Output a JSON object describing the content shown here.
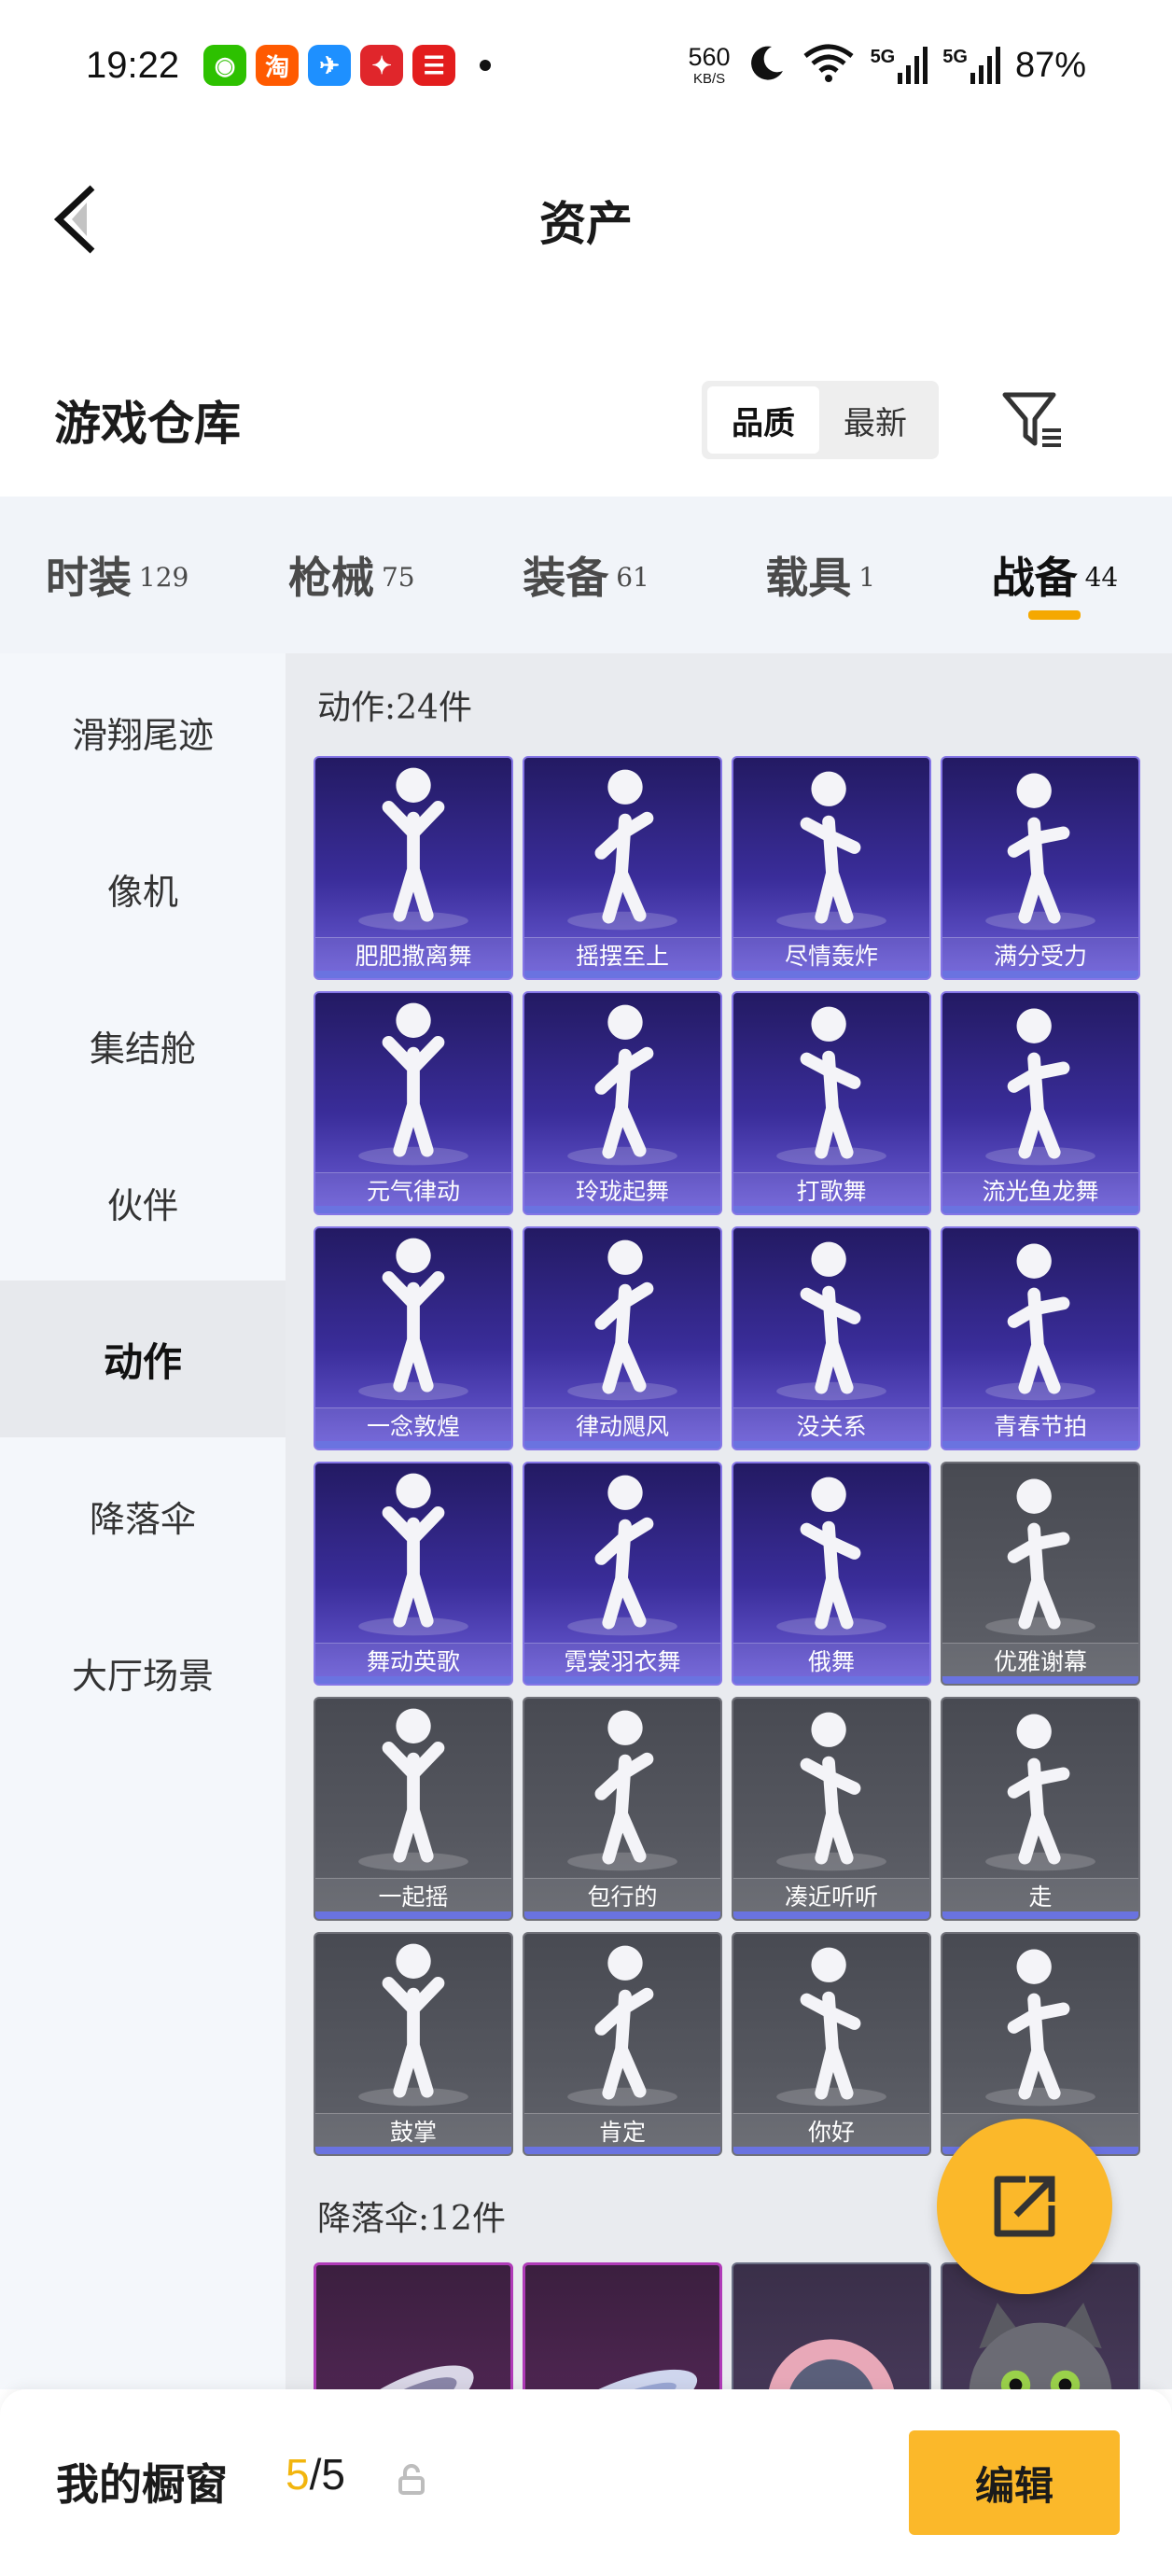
{
  "status_bar": {
    "time": "19:22",
    "apps": [
      {
        "name": "wechat-icon",
        "glyph": "◉",
        "color": "#2dc100"
      },
      {
        "name": "taobao-icon",
        "glyph": "淘",
        "color": "#ff5a00"
      },
      {
        "name": "messenger-icon",
        "glyph": "✈",
        "color": "#1e90ff"
      },
      {
        "name": "bank-icon",
        "glyph": "✦",
        "color": "#e0262b"
      },
      {
        "name": "unionpay-icon",
        "glyph": "☰",
        "color": "#e31d1d"
      }
    ],
    "net_speed": "560",
    "net_unit": "KB/S",
    "signal1": "5G",
    "signal2": "5G",
    "battery": "87%"
  },
  "header": {
    "title": "资产"
  },
  "section": {
    "title": "游戏仓库",
    "sort_options": [
      "品质",
      "最新"
    ],
    "active_sort": "品质"
  },
  "tabs": [
    {
      "label": "时装",
      "count": "129"
    },
    {
      "label": "枪械",
      "count": "75"
    },
    {
      "label": "装备",
      "count": "61"
    },
    {
      "label": "载具",
      "count": "1"
    },
    {
      "label": "战备",
      "count": "44"
    }
  ],
  "active_tab": "战备",
  "sidebar": {
    "items": [
      "滑翔尾迹",
      "像机",
      "集结舱",
      "伙伴",
      "动作",
      "降落伞",
      "大厅场景"
    ],
    "active": "动作"
  },
  "actions_group": {
    "title": "动作:24件",
    "items": [
      {
        "name": "肥肥撒离舞",
        "style": "purple"
      },
      {
        "name": "摇摆至上",
        "style": "purple"
      },
      {
        "name": "尽情轰炸",
        "style": "purple"
      },
      {
        "name": "满分受力",
        "style": "purple"
      },
      {
        "name": "元气律动",
        "style": "purple"
      },
      {
        "name": "玲珑起舞",
        "style": "purple"
      },
      {
        "name": "打歌舞",
        "style": "purple"
      },
      {
        "name": "流光鱼龙舞",
        "style": "purple"
      },
      {
        "name": "一念敦煌",
        "style": "purple"
      },
      {
        "name": "律动飓风",
        "style": "purple"
      },
      {
        "name": "没关系",
        "style": "purple"
      },
      {
        "name": "青春节拍",
        "style": "purple"
      },
      {
        "name": "舞动英歌",
        "style": "purple"
      },
      {
        "name": "霓裳羽衣舞",
        "style": "purple"
      },
      {
        "name": "俄舞",
        "style": "purple"
      },
      {
        "name": "优雅谢幕",
        "style": "grey"
      },
      {
        "name": "一起摇",
        "style": "grey"
      },
      {
        "name": "包行的",
        "style": "grey"
      },
      {
        "name": "凑近听听",
        "style": "grey"
      },
      {
        "name": "走",
        "style": "grey"
      },
      {
        "name": "鼓掌",
        "style": "grey"
      },
      {
        "name": "肯定",
        "style": "grey"
      },
      {
        "name": "你好",
        "style": "grey"
      },
      {
        "name": "",
        "style": "grey"
      }
    ]
  },
  "parachute_group": {
    "title": "降落伞:12件"
  },
  "bottom_bar": {
    "title": "我的橱窗",
    "current": "5",
    "separator": "/",
    "total": "5",
    "edit_label": "编辑"
  },
  "colors": {
    "accent": "#fbb82a",
    "tab_underline": "#f5a800",
    "card_purple": "#3a2d9a",
    "card_grey": "#55575f"
  }
}
